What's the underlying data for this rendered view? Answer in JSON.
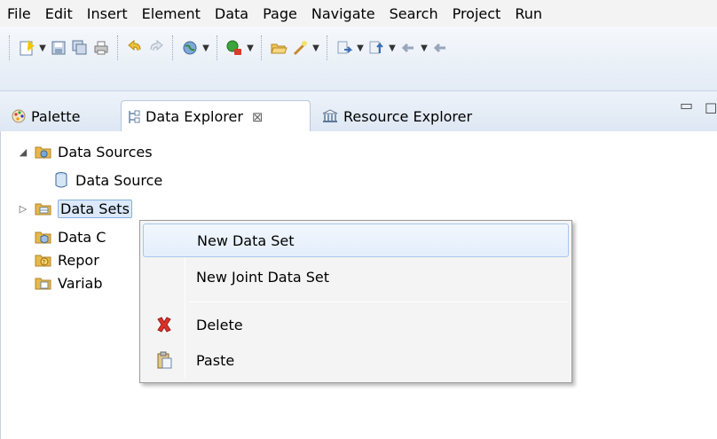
{
  "menubar": {
    "items": [
      "File",
      "Edit",
      "Insert",
      "Element",
      "Data",
      "Page",
      "Navigate",
      "Search",
      "Project",
      "Run"
    ]
  },
  "toolbar": {
    "buttons": [
      "new-icon",
      "save-icon",
      "save-all-icon",
      "print-icon",
      "undo-icon",
      "redo-icon",
      "web-icon",
      "run-icon",
      "open-icon",
      "wand-icon",
      "step-icon",
      "up-icon",
      "back-icon",
      "forward-icon"
    ]
  },
  "tabs": {
    "palette": "Palette",
    "data_explorer": "Data Explorer",
    "resource_explorer": "Resource Explorer",
    "close_glyph": "⊠"
  },
  "tree": {
    "data_sources": "Data Sources",
    "data_source": "Data Source",
    "data_sets": "Data Sets",
    "data_cubes": "Data C",
    "report_params": "Repor",
    "variables": "Variab"
  },
  "context_menu": {
    "new_data_set": "New Data Set",
    "new_joint_data_set": "New Joint Data Set",
    "delete": "Delete",
    "paste": "Paste"
  },
  "colors": {
    "selection_bg": "#dbe9fb",
    "selection_border": "#89aee0",
    "folder_yellow": "#e8b84a",
    "delete_red": "#d9322b"
  }
}
